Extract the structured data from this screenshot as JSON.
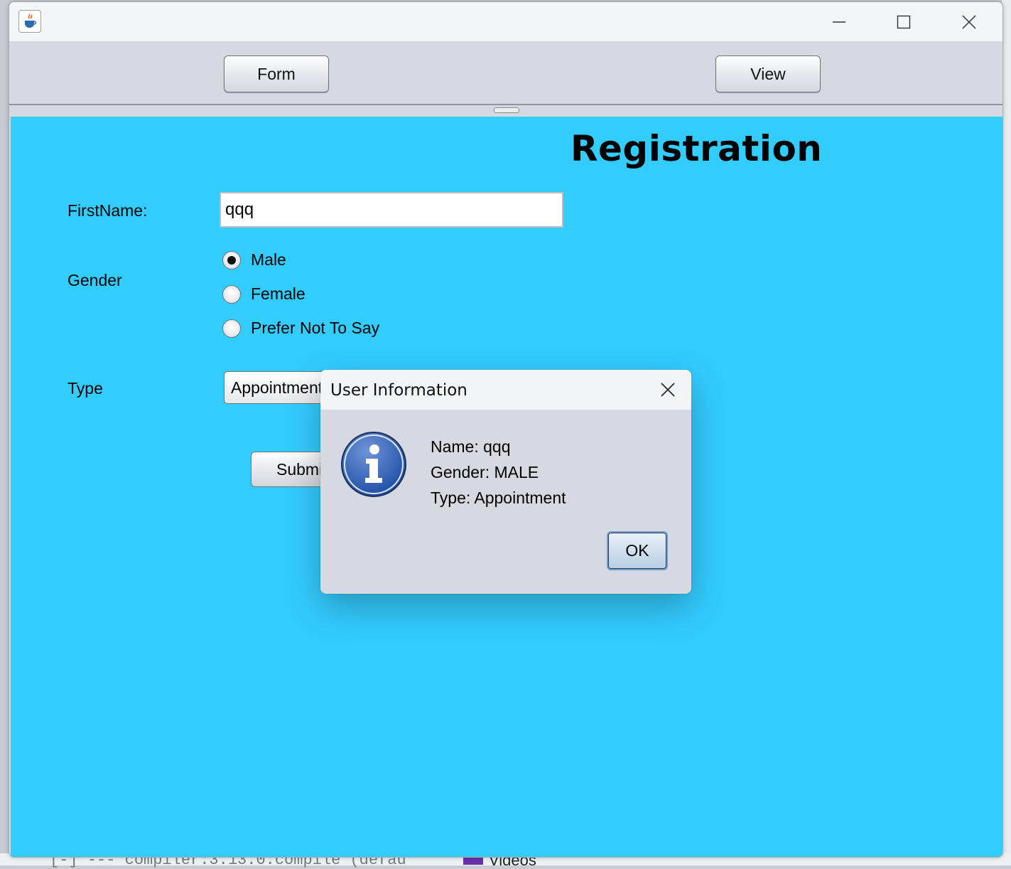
{
  "background": {
    "console_text": "[-]  --- compiler:3.13.0:compile (defau",
    "videos_label": "Videos"
  },
  "window": {
    "icons": {
      "app": "java-cup-icon",
      "minimize": "minimize-icon",
      "maximize": "maximize-icon",
      "close": "close-icon"
    }
  },
  "toolbar": {
    "form_label": "Form",
    "view_label": "View"
  },
  "form": {
    "title": "Registration",
    "first_name_label": "FirstName:",
    "first_name_value": "qqq",
    "gender_label": "Gender",
    "gender_options": [
      "Male",
      "Female",
      "Prefer Not To Say"
    ],
    "gender_selected": "Male",
    "type_label": "Type",
    "type_value": "Appointment",
    "submit_label": "Submit",
    "background_color": "#33ccff"
  },
  "dialog": {
    "title": "User Information",
    "icon": "info-icon",
    "lines": [
      "Name: qqq",
      "Gender: MALE",
      "Type: Appointment"
    ],
    "ok_label": "OK"
  }
}
